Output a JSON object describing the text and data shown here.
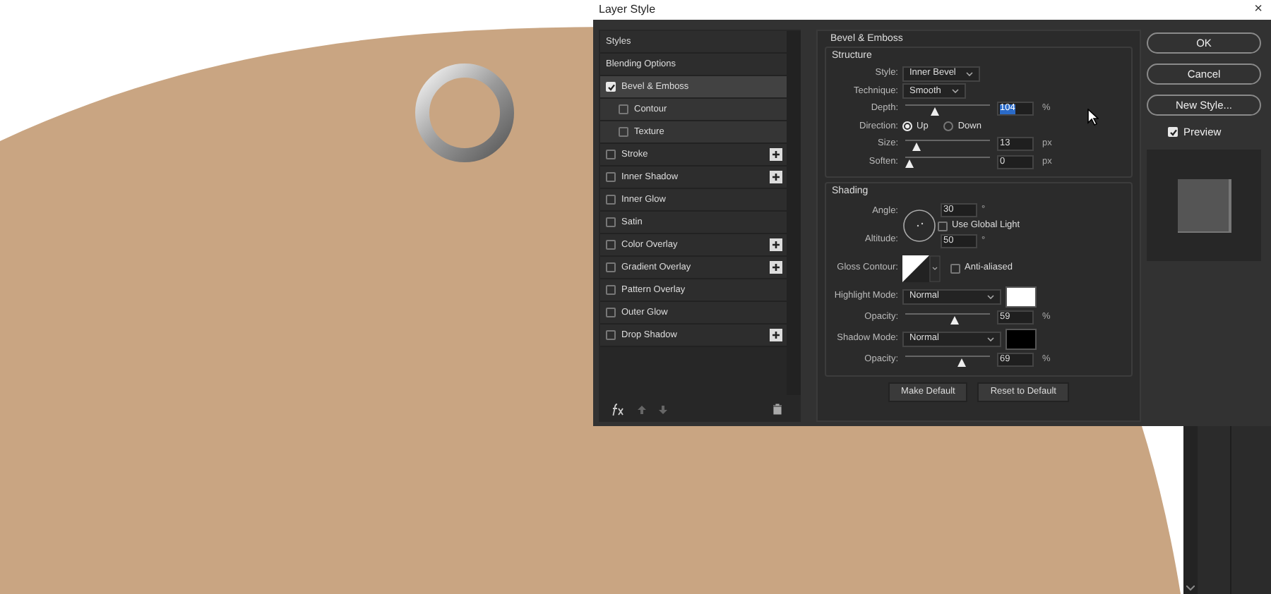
{
  "window": {
    "title": "Layer Style",
    "close": "×"
  },
  "styles_list": [
    {
      "kind": "header",
      "label": "Styles",
      "selected": false
    },
    {
      "kind": "header",
      "label": "Blending Options",
      "selected": false
    },
    {
      "kind": "effect",
      "label": "Bevel & Emboss",
      "checked": true,
      "selected": true,
      "add": false,
      "children": [
        {
          "kind": "effect",
          "label": "Contour",
          "checked": false,
          "selected": false,
          "add": false
        },
        {
          "kind": "effect",
          "label": "Texture",
          "checked": false,
          "selected": false,
          "add": false
        }
      ]
    },
    {
      "kind": "effect",
      "label": "Stroke",
      "checked": false,
      "selected": false,
      "add": true
    },
    {
      "kind": "effect",
      "label": "Inner Shadow",
      "checked": false,
      "selected": false,
      "add": true
    },
    {
      "kind": "effect",
      "label": "Inner Glow",
      "checked": false,
      "selected": false,
      "add": false
    },
    {
      "kind": "effect",
      "label": "Satin",
      "checked": false,
      "selected": false,
      "add": false
    },
    {
      "kind": "effect",
      "label": "Color Overlay",
      "checked": false,
      "selected": false,
      "add": true
    },
    {
      "kind": "effect",
      "label": "Gradient Overlay",
      "checked": false,
      "selected": false,
      "add": true
    },
    {
      "kind": "effect",
      "label": "Pattern Overlay",
      "checked": false,
      "selected": false,
      "add": false
    },
    {
      "kind": "effect",
      "label": "Outer Glow",
      "checked": false,
      "selected": false,
      "add": false
    },
    {
      "kind": "effect",
      "label": "Drop Shadow",
      "checked": false,
      "selected": false,
      "add": true
    }
  ],
  "panel": {
    "title": "Bevel & Emboss",
    "structure": {
      "title": "Structure",
      "rows": [
        {
          "kind": "dropdown",
          "label": "Style:",
          "value": "Inner Bevel"
        },
        {
          "kind": "dropdown",
          "label": "Technique:",
          "value": "Smooth"
        },
        {
          "kind": "slider",
          "label": "Depth:",
          "level": 0.33,
          "value": "104",
          "unit": "%",
          "text_selected": true
        },
        {
          "kind": "radio",
          "label": "Direction:",
          "options": [
            {
              "label": "Up",
              "selected": true
            },
            {
              "label": "Down",
              "selected": false
            }
          ]
        },
        {
          "kind": "slider",
          "label": "Size:",
          "level": 0.1,
          "value": "13",
          "unit": "px",
          "text_selected": false
        },
        {
          "kind": "slider",
          "label": "Soften:",
          "level": 0,
          "value": "0",
          "unit": "px",
          "text_selected": false
        }
      ]
    },
    "shading": {
      "title": "Shading",
      "angle": {
        "label": "Angle:",
        "value": "30",
        "unit": "°",
        "global_light": {
          "label": "Use Global Light",
          "checked": false
        }
      },
      "altitude": {
        "label": "Altitude:",
        "value": "50",
        "unit": "°"
      },
      "gloss_contour": {
        "label": "Gloss Contour:",
        "anti_aliased": {
          "label": "Anti-aliased",
          "checked": false
        }
      },
      "rows": [
        {
          "kind": "mode",
          "label": "Highlight Mode:",
          "value": "Normal",
          "color": "#ffffff"
        },
        {
          "kind": "slider",
          "label": "Opacity:",
          "level": 0.59,
          "value": "59",
          "unit": "%"
        },
        {
          "kind": "mode",
          "label": "Shadow Mode:",
          "value": "Normal",
          "color": "#000000"
        },
        {
          "kind": "slider",
          "label": "Opacity:",
          "level": 0.69,
          "value": "69",
          "unit": "%"
        }
      ]
    },
    "buttons": [
      "Make Default",
      "Reset to Default"
    ]
  },
  "actions": [
    "OK",
    "Cancel",
    "New Style..."
  ],
  "preview": {
    "label": "Preview",
    "checked": true
  }
}
